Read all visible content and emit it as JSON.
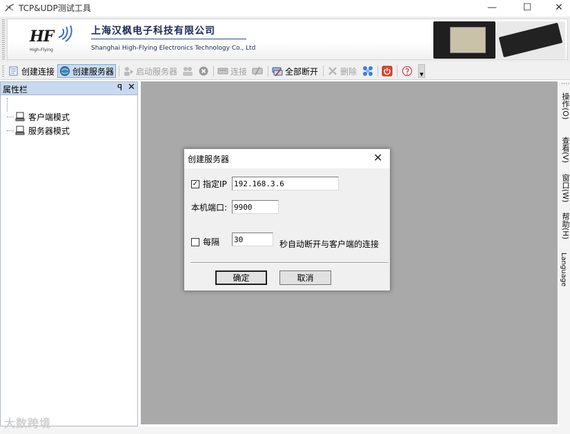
{
  "window": {
    "title": "TCP&UDP测试工具",
    "minimize_glyph": "—",
    "maximize_glyph": "☐",
    "close_glyph": "✕"
  },
  "banner": {
    "logo_text": "HF",
    "logo_sub": "High-Flying",
    "company_cn": "上海汉枫电子科技有限公司",
    "company_en": "Shanghai High-Flying Electronics Technology Co., Ltd"
  },
  "toolbar": {
    "items": [
      {
        "label": "创建连接",
        "icon": "create-connection-icon",
        "state": "normal"
      },
      {
        "label": "创建服务器",
        "icon": "create-server-icon",
        "state": "active"
      },
      {
        "label": "启动服务器",
        "icon": "start-server-icon",
        "state": "disabled"
      },
      {
        "label": "",
        "icon": "server-users-icon",
        "state": "disabled"
      },
      {
        "label": "",
        "icon": "stop-circle-icon",
        "state": "disabled"
      },
      {
        "label": "连接",
        "icon": "connect-icon",
        "state": "disabled"
      },
      {
        "label": "",
        "icon": "disconnect-icon",
        "state": "disabled"
      },
      {
        "label": "全部断开",
        "icon": "disconnect-all-icon",
        "state": "normal"
      },
      {
        "label": "删除",
        "icon": "delete-icon",
        "state": "disabled"
      },
      {
        "label": "",
        "icon": "network-icon",
        "state": "normal"
      },
      {
        "label": "",
        "icon": "power-icon",
        "state": "normal"
      },
      {
        "label": "",
        "icon": "help-icon",
        "state": "normal"
      }
    ]
  },
  "panel": {
    "title": "属性栏",
    "pin_glyph": "ꟼ",
    "close_glyph": "✕",
    "tree": [
      {
        "label": "客户端模式"
      },
      {
        "label": "服务器模式"
      }
    ]
  },
  "right_menu": {
    "items": [
      "操作(O)",
      "查看(V)",
      "窗口(W)",
      "帮助(H)",
      "Language"
    ]
  },
  "dialog": {
    "title": "创建服务器",
    "close_glyph": "✕",
    "specify_ip_label": "指定IP",
    "specify_ip_checked": true,
    "ip_value": "192.168.3.6",
    "port_label": "本机端口:",
    "port_value": "9900",
    "interval_label": "每隔",
    "interval_checked": false,
    "interval_value": "30",
    "interval_suffix": "秒自动断开与客户端的连接",
    "ok_label": "确定",
    "cancel_label": "取消"
  },
  "watermark": "大数跨境",
  "colors": {
    "panel_header": "#c9daf0",
    "workspace": "#a9a9a9",
    "active_button": "#c7dcf2"
  }
}
